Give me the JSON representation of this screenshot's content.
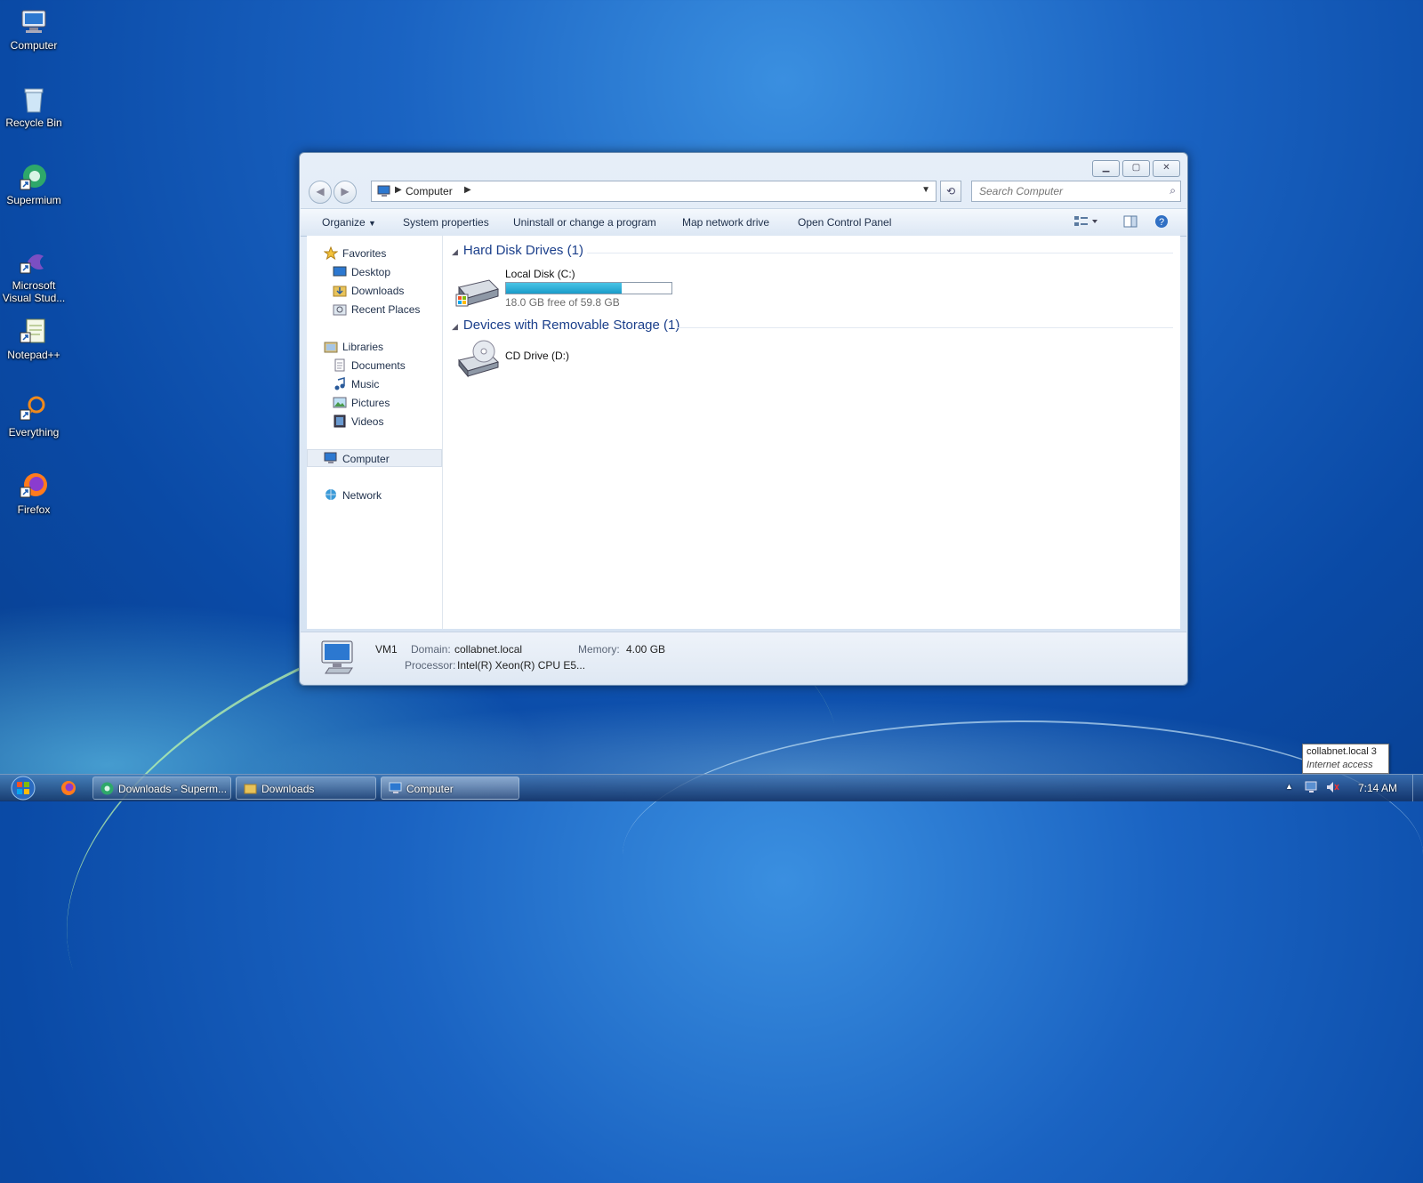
{
  "desktop": {
    "icons": [
      {
        "label": "Computer"
      },
      {
        "label": "Recycle Bin"
      },
      {
        "label": "Supermium"
      },
      {
        "label": "Microsoft Visual Stud..."
      },
      {
        "label": "Notepad++"
      },
      {
        "label": "Everything"
      },
      {
        "label": "Firefox"
      }
    ]
  },
  "window": {
    "address": {
      "crumb": "Computer"
    },
    "search": {
      "placeholder": "Search Computer"
    },
    "toolbar": {
      "organize": "Organize",
      "system_properties": "System properties",
      "uninstall": "Uninstall or change a program",
      "map_drive": "Map network drive",
      "control_panel": "Open Control Panel"
    },
    "nav": {
      "favorites": "Favorites",
      "desktop": "Desktop",
      "downloads": "Downloads",
      "recent": "Recent Places",
      "libraries": "Libraries",
      "documents": "Documents",
      "music": "Music",
      "pictures": "Pictures",
      "videos": "Videos",
      "computer": "Computer",
      "network": "Network"
    },
    "groups": {
      "hdd": {
        "title": "Hard Disk Drives (1)"
      },
      "removable": {
        "title": "Devices with Removable Storage (1)"
      }
    },
    "drives": {
      "c": {
        "name": "Local Disk (C:)",
        "free_text": "18.0 GB free of 59.8 GB",
        "used_fraction": 0.699
      },
      "d": {
        "name": "CD Drive (D:)"
      }
    },
    "details": {
      "name": "VM1",
      "domain_label": "Domain:",
      "domain": "collabnet.local",
      "memory_label": "Memory:",
      "memory": "4.00 GB",
      "processor_label": "Processor:",
      "processor": "Intel(R) Xeon(R) CPU E5..."
    }
  },
  "taskbar": {
    "buttons": [
      {
        "label": "Downloads - Superm..."
      },
      {
        "label": "Downloads"
      },
      {
        "label": "Computer"
      }
    ],
    "time": "7:14 AM",
    "tooltip": {
      "line1": "collabnet.local  3",
      "line2": "Internet access"
    }
  }
}
